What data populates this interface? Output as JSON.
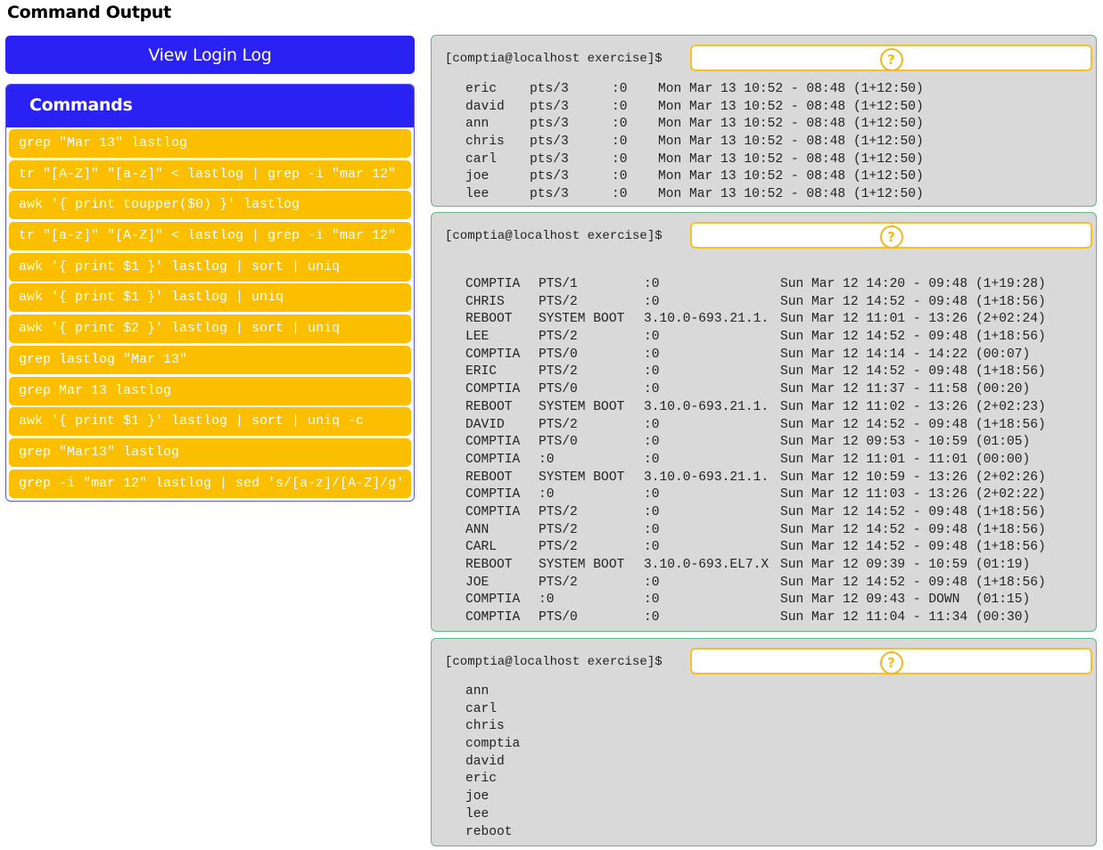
{
  "page": {
    "title": "Command Output"
  },
  "left": {
    "view_login_log_label": "View Login Log",
    "commands_header": "Commands",
    "commands": [
      "grep \"Mar 13\" lastlog",
      "tr \"[A-Z]\" \"[a-z]\" < lastlog | grep -i \"mar 12\"",
      "awk '{ print toupper($0) }' lastlog",
      "tr \"[a-z]\" \"[A-Z]\" < lastlog | grep -i \"mar 12\"",
      "awk '{ print $1 }' lastlog | sort | uniq",
      "awk '{ print $1 }' lastlog | uniq",
      "awk '{ print $2 }' lastlog | sort | uniq",
      "grep lastlog \"Mar 13\"",
      "grep Mar 13 lastlog",
      "awk '{ print $1 }' lastlog | sort | uniq -c",
      "grep \"Mar13\" lastlog",
      "grep -i \"mar 12\" lastlog | sed 's/[a-z]/[A-Z]/g'"
    ]
  },
  "terminals": [
    {
      "prompt": "[comptia@localhost exercise]$",
      "dropzone_icon": "?",
      "rows": [
        [
          "eric",
          "pts/3",
          ":0",
          "Mon Mar 13 10:52 - 08:48 (1+12:50)"
        ],
        [
          "david",
          "pts/3",
          ":0",
          "Mon Mar 13 10:52 - 08:48 (1+12:50)"
        ],
        [
          "ann",
          "pts/3",
          ":0",
          "Mon Mar 13 10:52 - 08:48 (1+12:50)"
        ],
        [
          "chris",
          "pts/3",
          ":0",
          "Mon Mar 13 10:52 - 08:48 (1+12:50)"
        ],
        [
          "carl",
          "pts/3",
          ":0",
          "Mon Mar 13 10:52 - 08:48 (1+12:50)"
        ],
        [
          "joe",
          "pts/3",
          ":0",
          "Mon Mar 13 10:52 - 08:48 (1+12:50)"
        ],
        [
          "lee",
          "pts/3",
          ":0",
          "Mon Mar 13 10:52 - 08:48 (1+12:50)"
        ]
      ]
    },
    {
      "prompt": "[comptia@localhost exercise]$",
      "dropzone_icon": "?",
      "rows": [
        [
          "COMPTIA",
          "PTS/1",
          ":0",
          "Sun Mar 12 14:20 - 09:48 (1+19:28)"
        ],
        [
          "CHRIS",
          "PTS/2",
          ":0",
          "Sun Mar 12 14:52 - 09:48 (1+18:56)"
        ],
        [
          "REBOOT",
          "SYSTEM BOOT",
          "3.10.0-693.21.1.",
          "Sun Mar 12 11:01 - 13:26 (2+02:24)"
        ],
        [
          "LEE",
          "PTS/2",
          ":0",
          "Sun Mar 12 14:52 - 09:48 (1+18:56)"
        ],
        [
          "COMPTIA",
          "PTS/0",
          ":0",
          "Sun Mar 12 14:14 - 14:22 (00:07)"
        ],
        [
          "ERIC",
          "PTS/2",
          ":0",
          "Sun Mar 12 14:52 - 09:48 (1+18:56)"
        ],
        [
          "COMPTIA",
          "PTS/0",
          ":0",
          "Sun Mar 12 11:37 - 11:58 (00:20)"
        ],
        [
          "REBOOT",
          "SYSTEM BOOT",
          "3.10.0-693.21.1.",
          "Sun Mar 12 11:02 - 13:26 (2+02:23)"
        ],
        [
          "DAVID",
          "PTS/2",
          ":0",
          "Sun Mar 12 14:52 - 09:48 (1+18:56)"
        ],
        [
          "COMPTIA",
          "PTS/0",
          ":0",
          "Sun Mar 12 09:53 - 10:59 (01:05)"
        ],
        [
          "COMPTIA",
          ":0",
          ":0",
          "Sun Mar 12 11:01 - 11:01 (00:00)"
        ],
        [
          "REBOOT",
          "SYSTEM BOOT",
          "3.10.0-693.21.1.",
          "Sun Mar 12 10:59 - 13:26 (2+02:26)"
        ],
        [
          "COMPTIA",
          ":0",
          ":0",
          "Sun Mar 12 11:03 - 13:26 (2+02:22)"
        ],
        [
          "COMPTIA",
          "PTS/2",
          ":0",
          "Sun Mar 12 14:52 - 09:48 (1+18:56)"
        ],
        [
          "ANN",
          "PTS/2",
          ":0",
          "Sun Mar 12 14:52 - 09:48 (1+18:56)"
        ],
        [
          "CARL",
          "PTS/2",
          ":0",
          "Sun Mar 12 14:52 - 09:48 (1+18:56)"
        ],
        [
          "REBOOT",
          "SYSTEM BOOT",
          "3.10.0-693.EL7.X",
          "Sun Mar 12 09:39 - 10:59 (01:19)"
        ],
        [
          "JOE",
          "PTS/2",
          ":0",
          "Sun Mar 12 14:52 - 09:48 (1+18:56)"
        ],
        [
          "COMPTIA",
          ":0",
          ":0",
          "Sun Mar 12 09:43 - DOWN  (01:15)"
        ],
        [
          "COMPTIA",
          "PTS/0",
          ":0",
          "Sun Mar 12 11:04 - 11:34 (00:30)"
        ]
      ]
    },
    {
      "prompt": "[comptia@localhost exercise]$",
      "dropzone_icon": "?",
      "rows": [
        [
          "ann"
        ],
        [
          "carl"
        ],
        [
          "chris"
        ],
        [
          "comptia"
        ],
        [
          "david"
        ],
        [
          "eric"
        ],
        [
          "joe"
        ],
        [
          "lee"
        ],
        [
          "reboot"
        ]
      ]
    }
  ]
}
